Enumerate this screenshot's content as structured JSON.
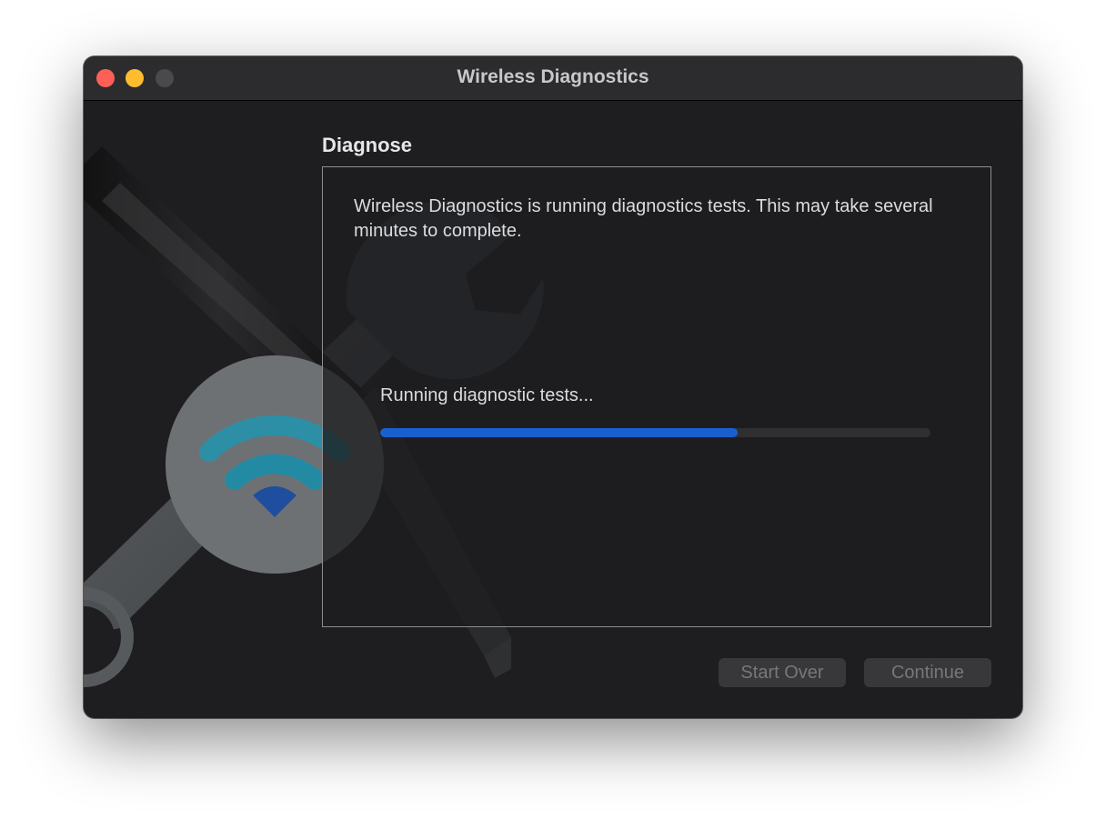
{
  "window": {
    "title": "Wireless Diagnostics"
  },
  "section": {
    "title": "Diagnose"
  },
  "panel": {
    "description": "Wireless Diagnostics is running diagnostics tests. This may take several minutes to complete.",
    "status": "Running diagnostic tests...",
    "progress": 0.65
  },
  "buttons": {
    "start_over": "Start Over",
    "continue": "Continue"
  },
  "icons": {
    "hero": "wifi-diagnostics-tools-icon",
    "wifi": "wifi-icon"
  },
  "colors": {
    "accent": "#1a5fd0",
    "close": "#fe5f57",
    "minimize": "#febc2e"
  }
}
